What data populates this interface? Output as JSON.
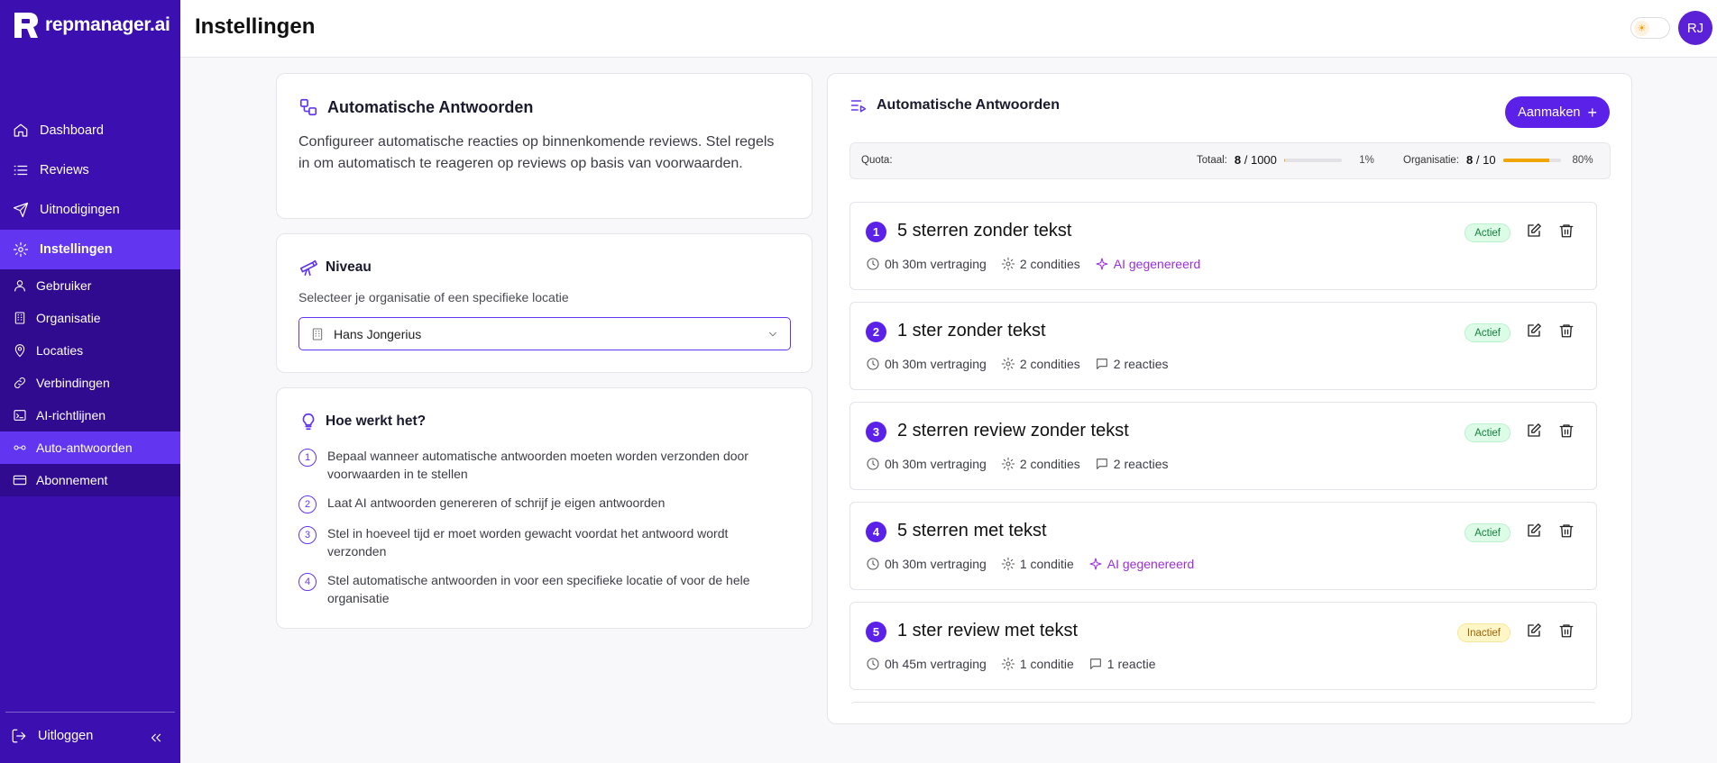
{
  "brand": {
    "name": "repmanager.ai"
  },
  "header": {
    "title": "Instellingen",
    "avatar_initials": "RJ"
  },
  "sidebar": {
    "items": [
      {
        "label": "Dashboard",
        "icon": "home-icon"
      },
      {
        "label": "Reviews",
        "icon": "list-icon"
      },
      {
        "label": "Uitnodigingen",
        "icon": "send-icon"
      },
      {
        "label": "Instellingen",
        "icon": "gear-icon",
        "active": true
      }
    ],
    "subitems": [
      {
        "label": "Gebruiker",
        "icon": "user-icon"
      },
      {
        "label": "Organisatie",
        "icon": "building-icon"
      },
      {
        "label": "Locaties",
        "icon": "map-pin-icon"
      },
      {
        "label": "Verbindingen",
        "icon": "link-icon"
      },
      {
        "label": "AI-richtlijnen",
        "icon": "ai-icon"
      },
      {
        "label": "Auto-antwoorden",
        "icon": "auto-reply-icon",
        "active": true
      },
      {
        "label": "Abonnement",
        "icon": "credit-card-icon"
      }
    ],
    "logout_label": "Uitloggen"
  },
  "intro": {
    "title": "Automatische Antwoorden",
    "text": "Configureer automatische reacties op binnenkomende reviews. Stel regels in om automatisch te reageren op reviews op basis van voorwaarden."
  },
  "niveau": {
    "title": "Niveau",
    "subtitle": "Selecteer je organisatie of een specifieke locatie",
    "selected": "Hans Jongerius"
  },
  "how": {
    "title": "Hoe werkt het?",
    "steps": [
      "Bepaal wanneer automatische antwoorden moeten worden verzonden door voorwaarden in te stellen",
      "Laat AI antwoorden genereren of schrijf je eigen antwoorden",
      "Stel in hoeveel tijd er moet worden gewacht voordat het antwoord wordt verzonden",
      "Stel automatische antwoorden in voor een specifieke locatie of voor de hele organisatie"
    ]
  },
  "list": {
    "title": "Automatische Antwoorden",
    "create_label": "Aanmaken",
    "quota": {
      "label": "Quota:",
      "total_label": "Totaal:",
      "total_used": "8",
      "total_max": "1000",
      "total_pct": "1%",
      "total_fraction": 0.01,
      "org_label": "Organisatie:",
      "org_used": "8",
      "org_max": "10",
      "org_pct": "80%",
      "org_fraction": 0.8
    },
    "rules": [
      {
        "num": "1",
        "title": "5 sterren zonder tekst",
        "delay": "0h 30m vertraging",
        "conditions": "2 condities",
        "extra": "AI gegenereerd",
        "extra_type": "ai",
        "status": "Actief",
        "active": true
      },
      {
        "num": "2",
        "title": "1 ster zonder tekst",
        "delay": "0h 30m vertraging",
        "conditions": "2 condities",
        "extra": "2 reacties",
        "extra_type": "reply",
        "status": "Actief",
        "active": true
      },
      {
        "num": "3",
        "title": "2 sterren review zonder tekst",
        "delay": "0h 30m vertraging",
        "conditions": "2 condities",
        "extra": "2 reacties",
        "extra_type": "reply",
        "status": "Actief",
        "active": true
      },
      {
        "num": "4",
        "title": "5 sterren met tekst",
        "delay": "0h 30m vertraging",
        "conditions": "1 conditie",
        "extra": "AI gegenereerd",
        "extra_type": "ai",
        "status": "Actief",
        "active": true
      },
      {
        "num": "5",
        "title": "1 ster review met tekst",
        "delay": "0h 45m vertraging",
        "conditions": "1 conditie",
        "extra": "1 reactie",
        "extra_type": "reply",
        "status": "Inactief",
        "active": false
      }
    ]
  },
  "colors": {
    "sidebar": "#3b0fb0",
    "accent": "#5b21e8",
    "active_nav": "#6236f0"
  }
}
